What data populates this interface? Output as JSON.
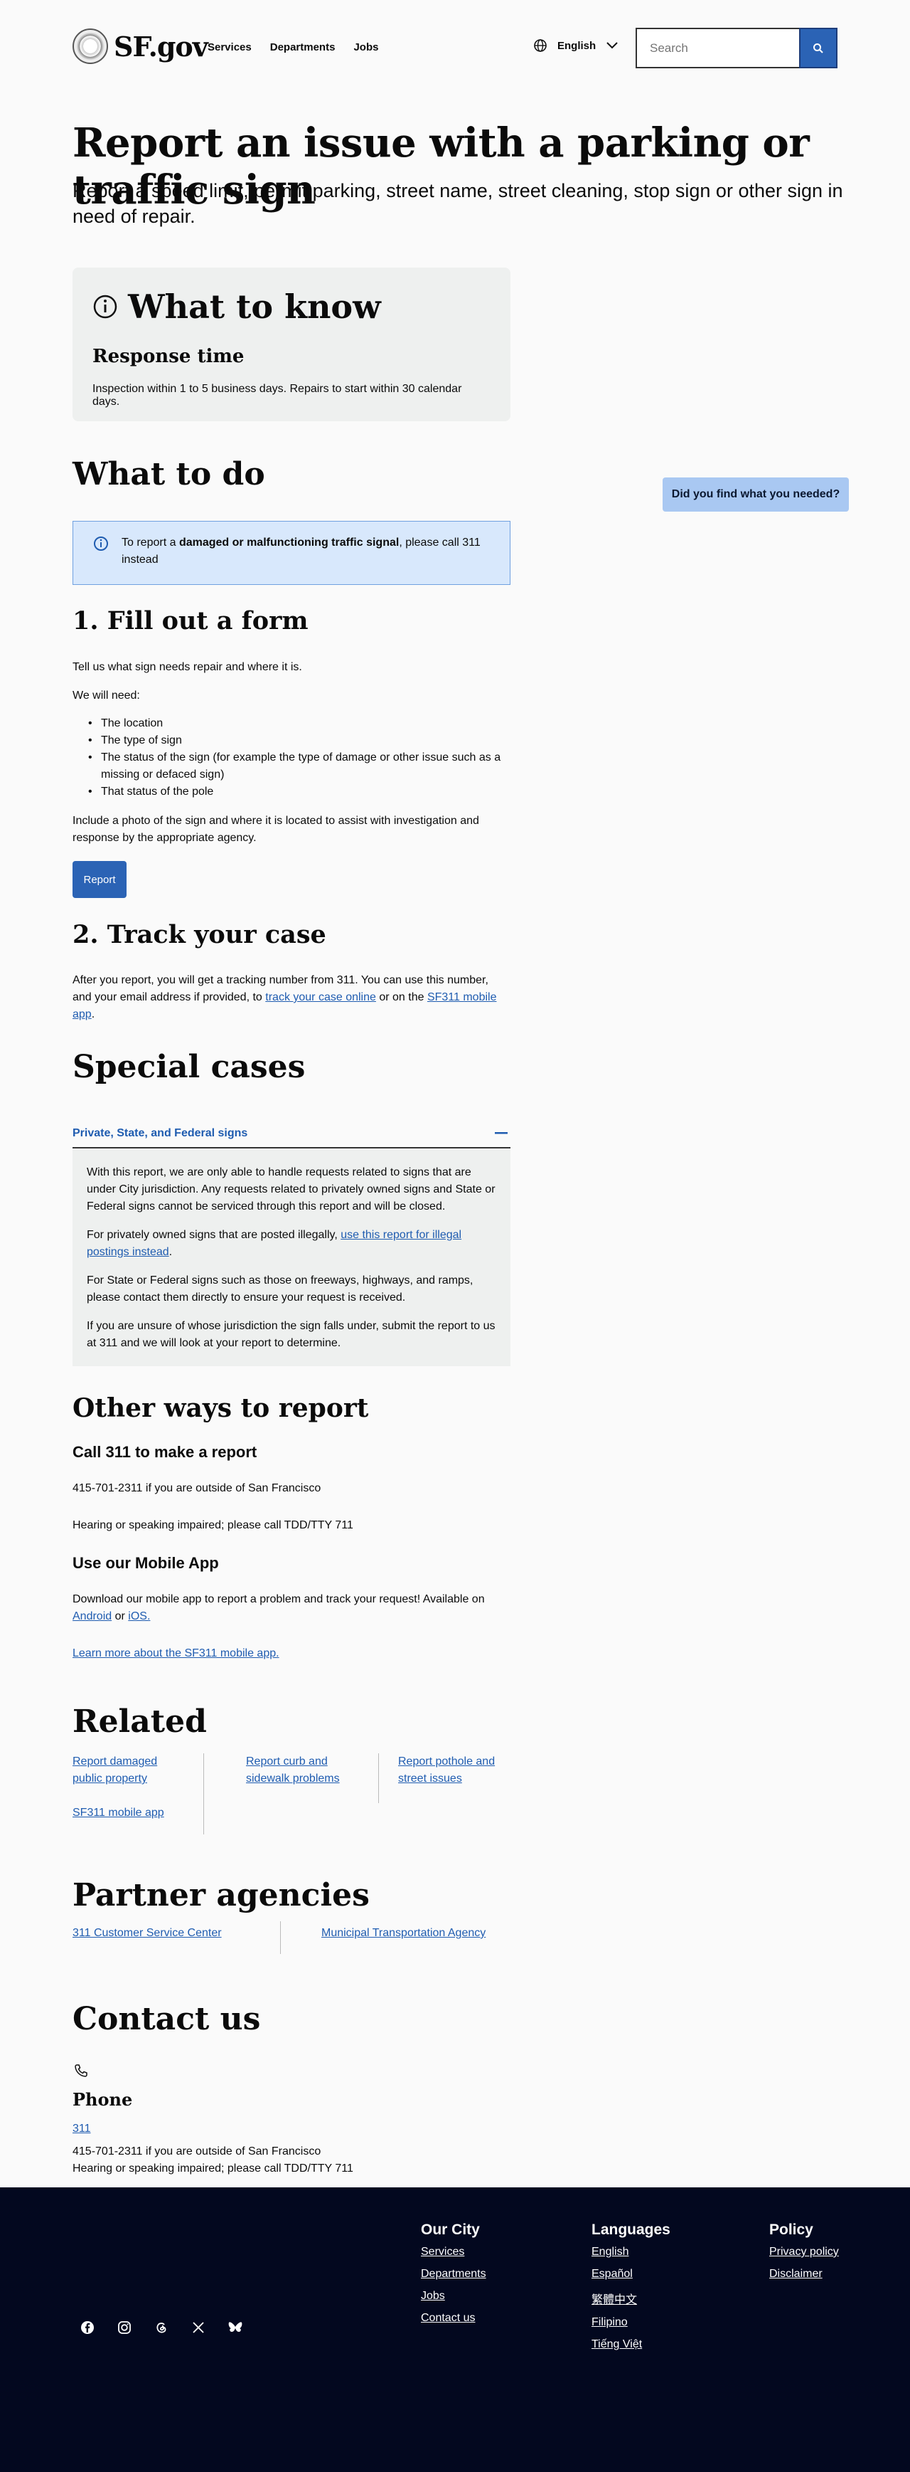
{
  "header": {
    "logo_text": "SF.gov",
    "nav": [
      "Services",
      "Departments",
      "Jobs"
    ],
    "language": "English",
    "search_placeholder": "Search"
  },
  "page": {
    "title": "Report an issue with a parking or traffic sign",
    "subtitle": "Report a speed limit, permit parking, street name, street cleaning, stop sign or other sign in need of repair."
  },
  "know": {
    "title": "What to know",
    "heading": "Response time",
    "text": "Inspection within 1 to 5 business days. Repairs to start within 30 calendar days."
  },
  "todo": {
    "title": "What to do",
    "feedback": "Did you find what you needed?",
    "alert_pre": "To report a ",
    "alert_bold": "damaged or malfunctioning traffic signal",
    "alert_post": ", please call 311 instead",
    "step1": "1. Fill out a form",
    "step1_intro": "Tell us what sign needs repair and where it is.",
    "need_label": "We will need:",
    "needs": [
      "The location",
      "The type of sign",
      "The status of the sign (for example the type of damage or other issue such as a missing or defaced sign)",
      "That status of the pole"
    ],
    "photo_note": "Include a photo of the sign and where it is located to assist with investigation and response by the appropriate agency.",
    "report_button": "Report",
    "step2": "2. Track your case",
    "track_pre": "After you report, you will get a tracking number from 311. You can use this number, and your email address if provided, to ",
    "track_link1": "track your case online",
    "track_mid": " or on the ",
    "track_link2": "SF311 mobile app",
    "track_post": "."
  },
  "special": {
    "title": "Special cases",
    "accordion_title": "Private, State, and Federal signs",
    "p1": "With this report, we are only able to handle requests related to signs that are under City jurisdiction. Any requests related to privately owned signs and State or Federal signs cannot be serviced through this report and will be closed.",
    "p2_pre": "For privately owned signs that are posted illegally, ",
    "p2_link": "use this report for illegal postings instead",
    "p2_post": ".",
    "p3": "For State or Federal signs such as those on freeways, highways, and ramps, please contact them directly to ensure your request is received.",
    "p4": "If you are unsure of whose jurisdiction the sign falls under, submit the report to us at 311 and we will look at your report to determine."
  },
  "other": {
    "title": "Other ways to report",
    "call_title": "Call 311 to make a report",
    "call_line1": "415-701-2311 if you are outside of San Francisco",
    "call_line2": "Hearing or speaking impaired; please call TDD/TTY 711",
    "app_title": "Use our Mobile App",
    "app_pre": "Download our mobile app to report a problem and track your request! Available on ",
    "app_android": "Android",
    "app_or": " or ",
    "app_ios": "iOS.",
    "app_learn": "Learn more about the SF311 mobile app."
  },
  "related": {
    "title": "Related",
    "links": [
      "Report damaged public property",
      "SF311 mobile app",
      "Report curb and sidewalk problems",
      "Report pothole and street issues"
    ]
  },
  "partners": {
    "title": "Partner agencies",
    "links": [
      "311 Customer Service Center",
      "Municipal Transportation Agency"
    ]
  },
  "contact": {
    "title": "Contact us",
    "phone_title": "Phone",
    "phone_link": "311",
    "line1": "415-701-2311 if you are outside of San Francisco",
    "line2": "Hearing or speaking impaired; please call TDD/TTY 711"
  },
  "footer": {
    "city_title": "Our City",
    "city_links": [
      "Services",
      "Departments",
      "Jobs",
      "Contact us"
    ],
    "lang_title": "Languages",
    "lang_links": [
      "English",
      "Español",
      "繁體中文",
      "Filipino",
      "Tiếng Việt"
    ],
    "policy_title": "Policy",
    "policy_links": [
      "Privacy policy",
      "Disclaimer"
    ],
    "socials": [
      "facebook-icon",
      "instagram-icon",
      "threads-icon",
      "x-icon",
      "bluesky-icon"
    ]
  },
  "colors": {
    "primary": "#2b63b5",
    "link": "#1f5cb0",
    "footer_bg": "#03081f",
    "alert_bg": "#d8e8fc",
    "card_bg": "#eef0ef",
    "feedback_bg": "#a9c8f2"
  }
}
